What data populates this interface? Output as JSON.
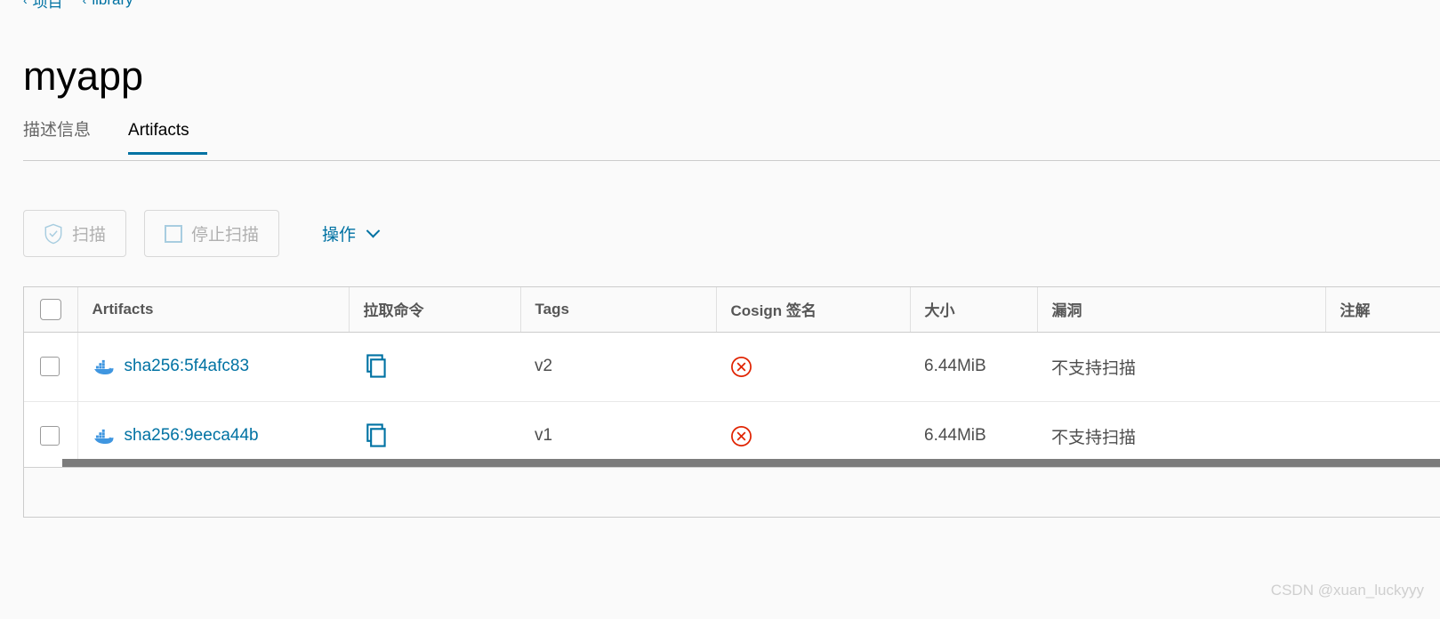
{
  "breadcrumb": {
    "items": [
      {
        "caret": "‹",
        "label": "项目"
      },
      {
        "caret": "‹",
        "label": "library"
      }
    ]
  },
  "page": {
    "title": "myapp"
  },
  "tabs": [
    {
      "label": "描述信息",
      "active": false
    },
    {
      "label": "Artifacts",
      "active": true
    }
  ],
  "toolbar": {
    "scan_label": "扫描",
    "stop_scan_label": "停止扫描",
    "actions_label": "操作"
  },
  "table": {
    "columns": [
      "Artifacts",
      "拉取命令",
      "Tags",
      "Cosign 签名",
      "大小",
      "漏洞",
      "注解"
    ],
    "rows": [
      {
        "artifact": "sha256:5f4afc83",
        "tags": "v2",
        "cosign": "not-signed",
        "size": "6.44MiB",
        "vulnerabilities": "不支持扫描",
        "annotations": ""
      },
      {
        "artifact": "sha256:9eeca44b",
        "tags": "v1",
        "cosign": "not-signed",
        "size": "6.44MiB",
        "vulnerabilities": "不支持扫描",
        "annotations": ""
      }
    ]
  },
  "watermark": {
    "text": "CSDN @xuan_luckyyy"
  },
  "colors": {
    "accent": "#0072a3",
    "danger": "#e02200",
    "docker_blue": "#2396ed",
    "page_bg": "#fafafa"
  }
}
